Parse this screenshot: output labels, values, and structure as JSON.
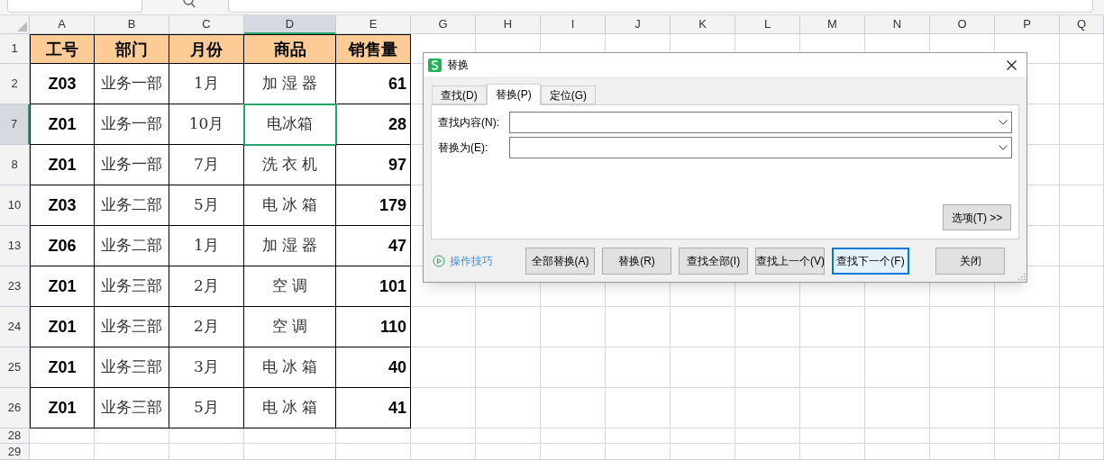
{
  "sheet": {
    "columns": [
      {
        "letter": "A",
        "selected": false
      },
      {
        "letter": "B",
        "selected": false
      },
      {
        "letter": "C",
        "selected": false
      },
      {
        "letter": "D",
        "selected": true
      },
      {
        "letter": "E",
        "selected": false
      },
      {
        "letter": "G",
        "selected": false
      },
      {
        "letter": "H",
        "selected": false
      },
      {
        "letter": "I",
        "selected": false
      },
      {
        "letter": "J",
        "selected": false
      },
      {
        "letter": "K",
        "selected": false
      },
      {
        "letter": "L",
        "selected": false
      },
      {
        "letter": "M",
        "selected": false
      },
      {
        "letter": "N",
        "selected": false
      },
      {
        "letter": "O",
        "selected": false
      },
      {
        "letter": "P",
        "selected": false
      },
      {
        "letter": "Q",
        "selected": false
      }
    ],
    "rows": [
      {
        "number": "1",
        "selected": false,
        "kind": "header",
        "cells": [
          "工号",
          "部门",
          "月份",
          "商品",
          "销售量"
        ]
      },
      {
        "number": "2",
        "selected": false,
        "kind": "data",
        "cells": [
          "Z03",
          "业务一部",
          "1月",
          "加 湿 器",
          "61"
        ]
      },
      {
        "number": "7",
        "selected": true,
        "kind": "data",
        "cells": [
          "Z01",
          "业务一部",
          "10月",
          "电冰箱",
          "28"
        ]
      },
      {
        "number": "8",
        "selected": false,
        "kind": "data",
        "cells": [
          "Z01",
          "业务一部",
          "7月",
          "洗 衣 机",
          "97"
        ]
      },
      {
        "number": "10",
        "selected": false,
        "kind": "data",
        "cells": [
          "Z03",
          "业务二部",
          "5月",
          "电 冰 箱",
          "179"
        ]
      },
      {
        "number": "13",
        "selected": false,
        "kind": "data",
        "cells": [
          "Z06",
          "业务二部",
          "1月",
          "加 湿 器",
          "47"
        ]
      },
      {
        "number": "23",
        "selected": false,
        "kind": "data",
        "cells": [
          "Z01",
          "业务三部",
          "2月",
          "空 调",
          "101"
        ]
      },
      {
        "number": "24",
        "selected": false,
        "kind": "data",
        "cells": [
          "Z01",
          "业务三部",
          "2月",
          "空 调",
          "110"
        ]
      },
      {
        "number": "25",
        "selected": false,
        "kind": "data",
        "cells": [
          "Z01",
          "业务三部",
          "3月",
          "电 冰 箱",
          "40"
        ]
      },
      {
        "number": "26",
        "selected": false,
        "kind": "data",
        "cells": [
          "Z01",
          "业务三部",
          "5月",
          "电 冰 箱",
          "41"
        ]
      },
      {
        "number": "28",
        "selected": false,
        "kind": "empty",
        "cells": []
      },
      {
        "number": "29",
        "selected": false,
        "kind": "empty",
        "cells": []
      }
    ]
  },
  "dialog": {
    "title": "替换",
    "tabs": [
      {
        "label": "查找(D)",
        "selected": false
      },
      {
        "label": "替换(P)",
        "selected": true
      },
      {
        "label": "定位(G)",
        "selected": false
      }
    ],
    "fields": [
      {
        "label": "查找内容(N):"
      },
      {
        "label": "替换为(E):"
      }
    ],
    "options_button": "选项(T) >>",
    "tips_link": "操作技巧",
    "buttons": [
      {
        "label": "全部替换(A)",
        "focused": false
      },
      {
        "label": "替换(R)",
        "focused": false
      },
      {
        "label": "查找全部(I)",
        "focused": false
      },
      {
        "label": "查找上一个(V)",
        "focused": false
      },
      {
        "label": "查找下一个(F)",
        "focused": true
      }
    ],
    "close_button": "关闭"
  }
}
